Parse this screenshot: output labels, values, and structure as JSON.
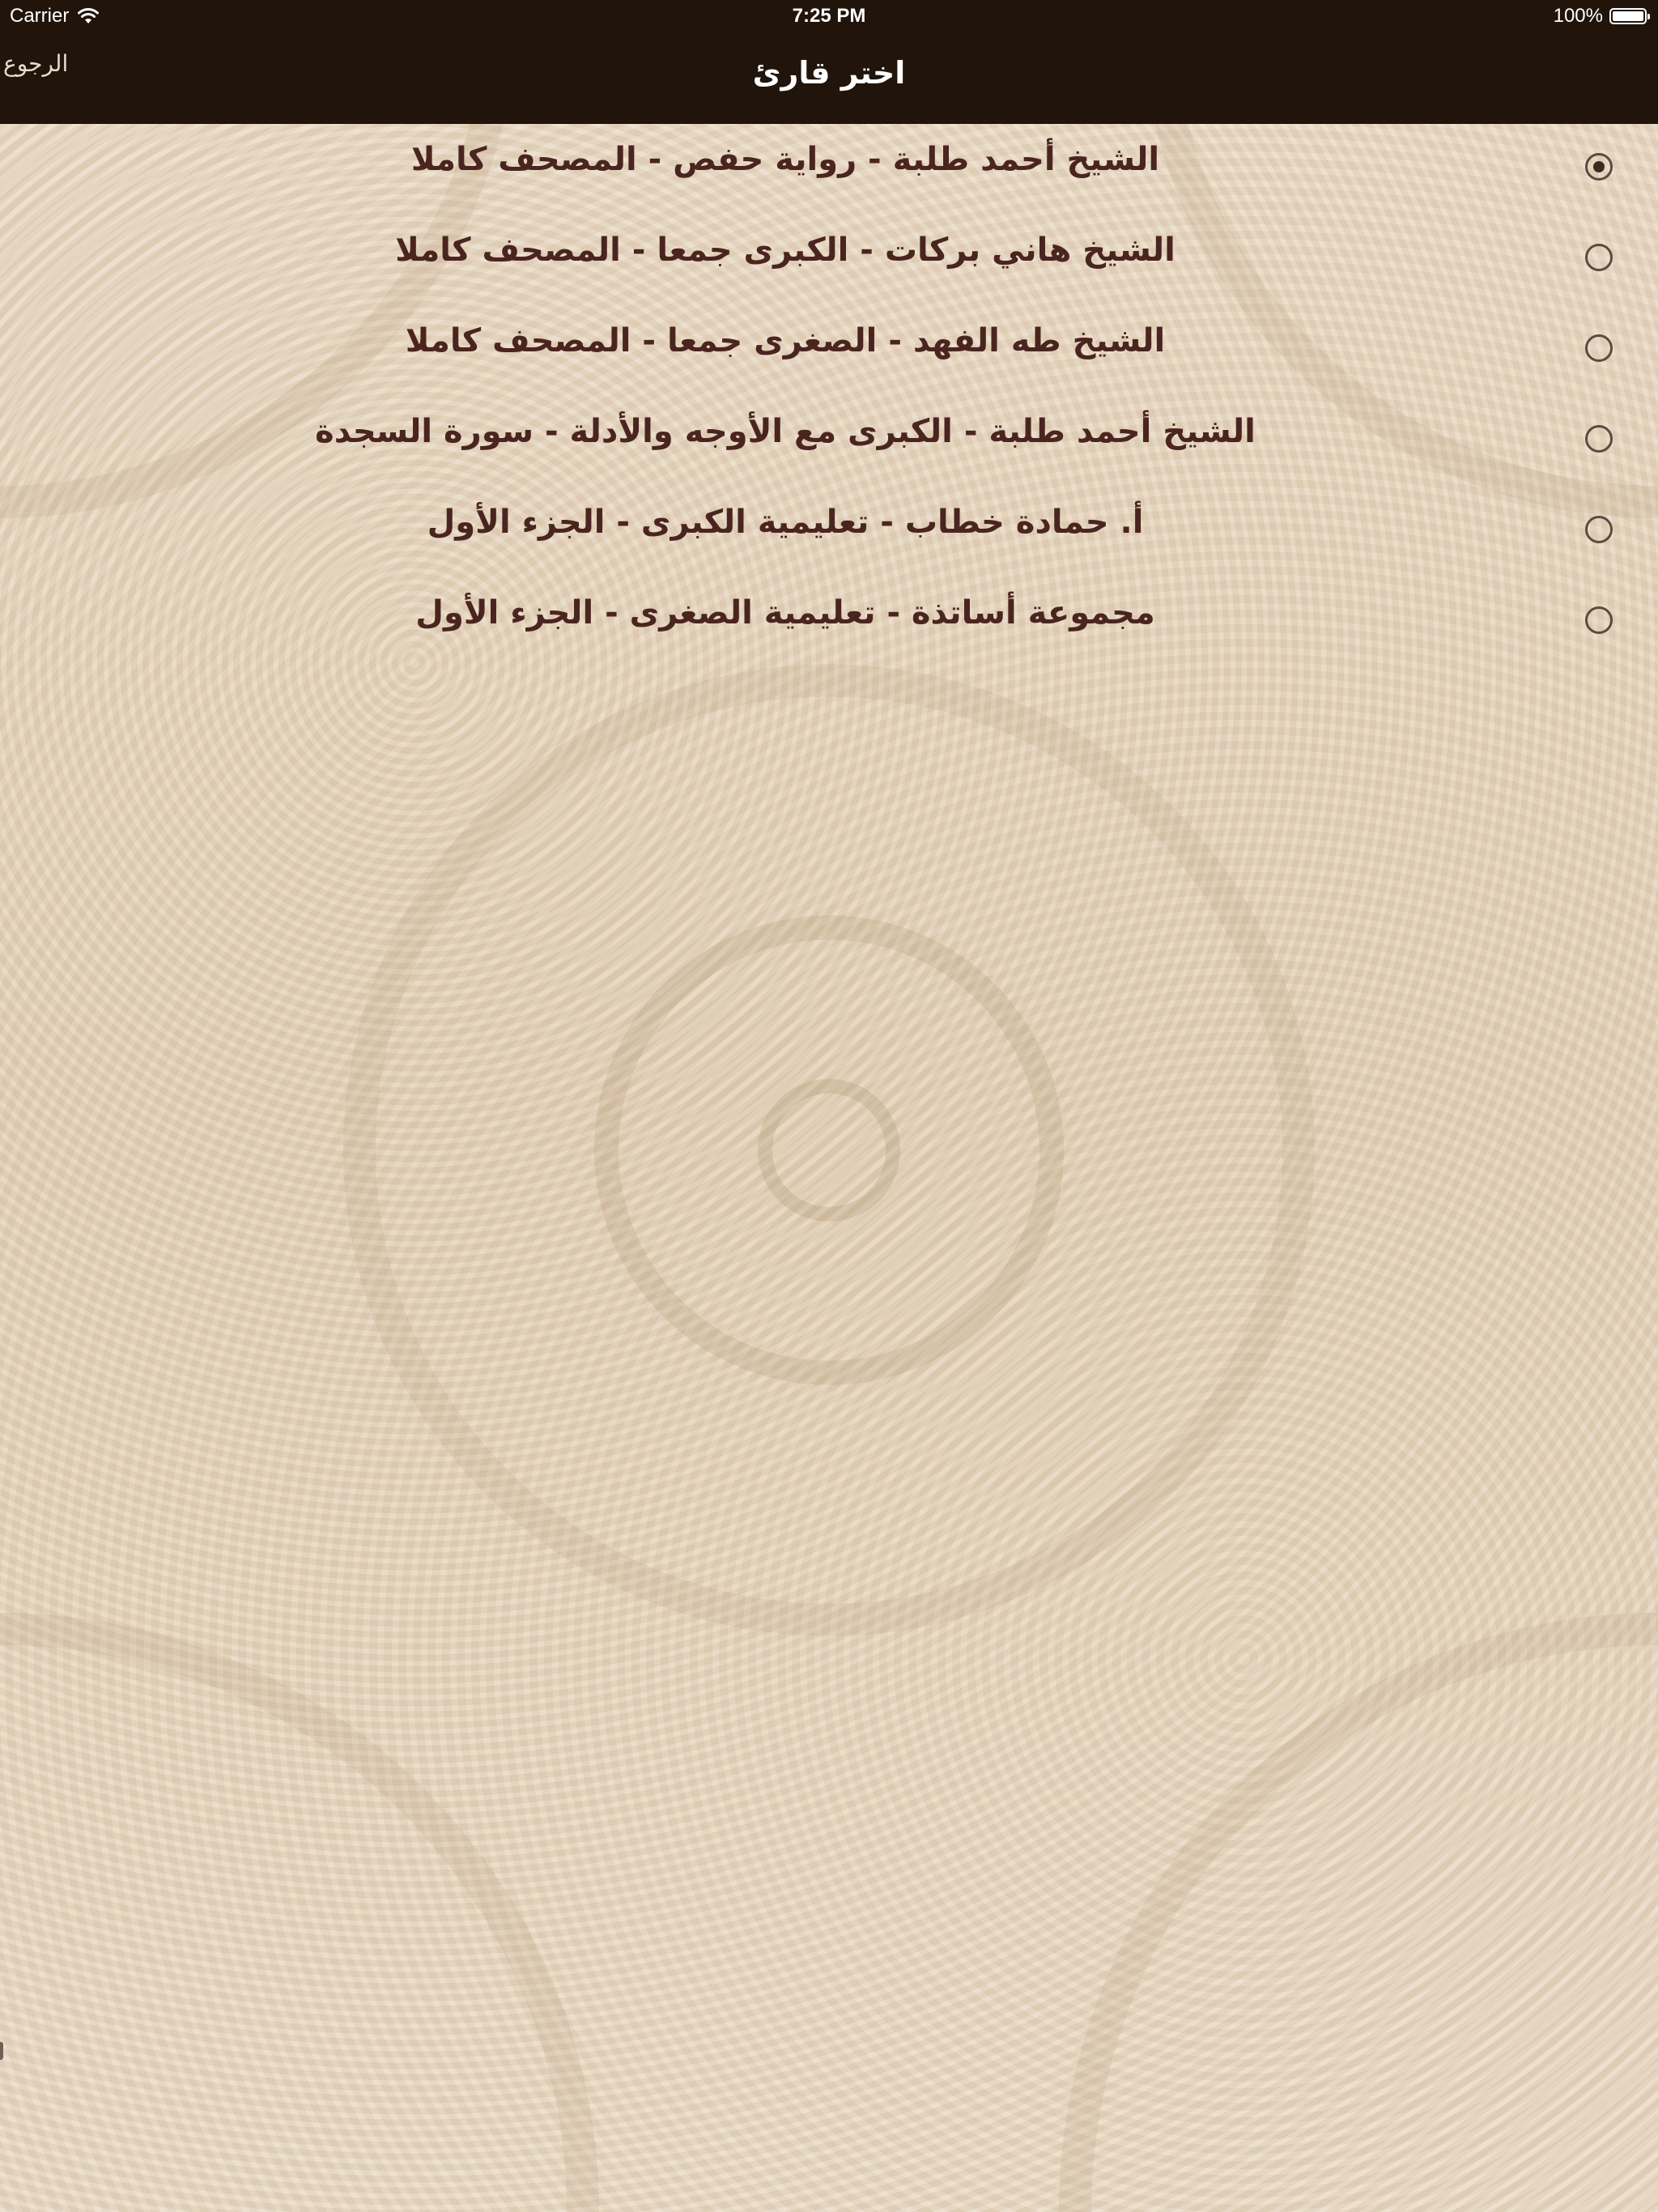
{
  "status_bar": {
    "carrier": "Carrier",
    "time": "7:25 PM",
    "battery": "100%"
  },
  "nav": {
    "title": "اختر قارئ",
    "back_label": "الرجوع"
  },
  "reciters": [
    {
      "label": "الشيخ أحمد طلبة - رواية حفص - المصحف كاملا",
      "selected": true
    },
    {
      "label": "الشيخ هاني بركات - الكبرى جمعا - المصحف كاملا",
      "selected": false
    },
    {
      "label": "الشيخ طه الفهد - الصغرى جمعا - المصحف كاملا",
      "selected": false
    },
    {
      "label": "الشيخ أحمد طلبة - الكبرى مع الأوجه والأدلة - سورة السجدة",
      "selected": false
    },
    {
      "label": "أ. حمادة خطاب - تعليمية الكبرى - الجزء الأول",
      "selected": false
    },
    {
      "label": "مجموعة أساتذة - تعليمية الصغرى - الجزء الأول",
      "selected": false
    }
  ]
}
